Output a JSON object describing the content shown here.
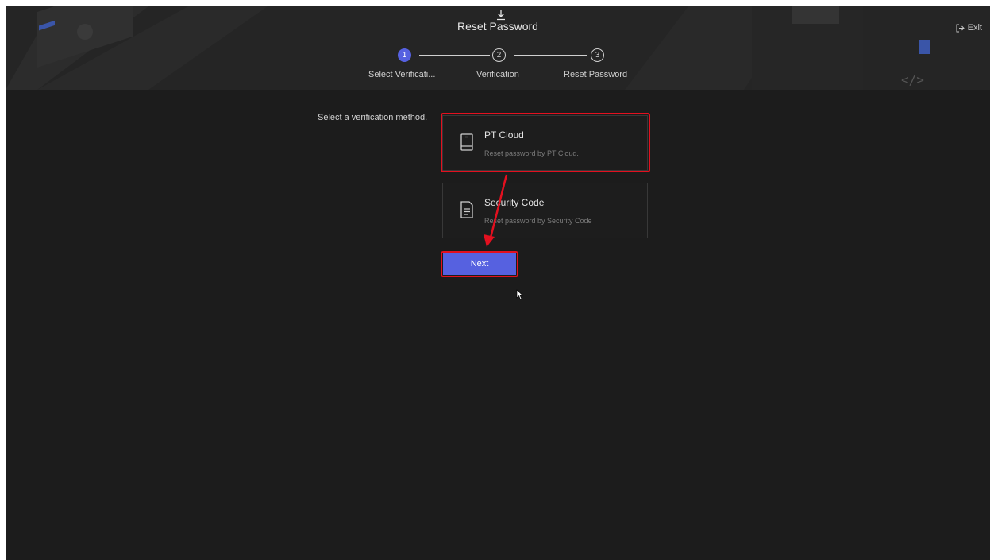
{
  "header": {
    "title": "Reset Password",
    "exit_label": "Exit"
  },
  "steps": [
    {
      "number": "1",
      "label": "Select Verificati...",
      "state": "active"
    },
    {
      "number": "2",
      "label": "Verification",
      "state": "pending"
    },
    {
      "number": "3",
      "label": "Reset Password",
      "state": "pending"
    }
  ],
  "main": {
    "prompt": "Select a verification method.",
    "methods": [
      {
        "title": "PT Cloud",
        "description": "Reset password by PT Cloud.",
        "icon": "mobile-device-icon",
        "selected": true
      },
      {
        "title": "Security Code",
        "description": "Reset password by Security Code",
        "icon": "document-icon",
        "selected": false
      }
    ],
    "next_label": "Next"
  },
  "colors": {
    "accent": "#5661e0",
    "highlight": "#e3101f",
    "background": "#1c1c1c"
  }
}
